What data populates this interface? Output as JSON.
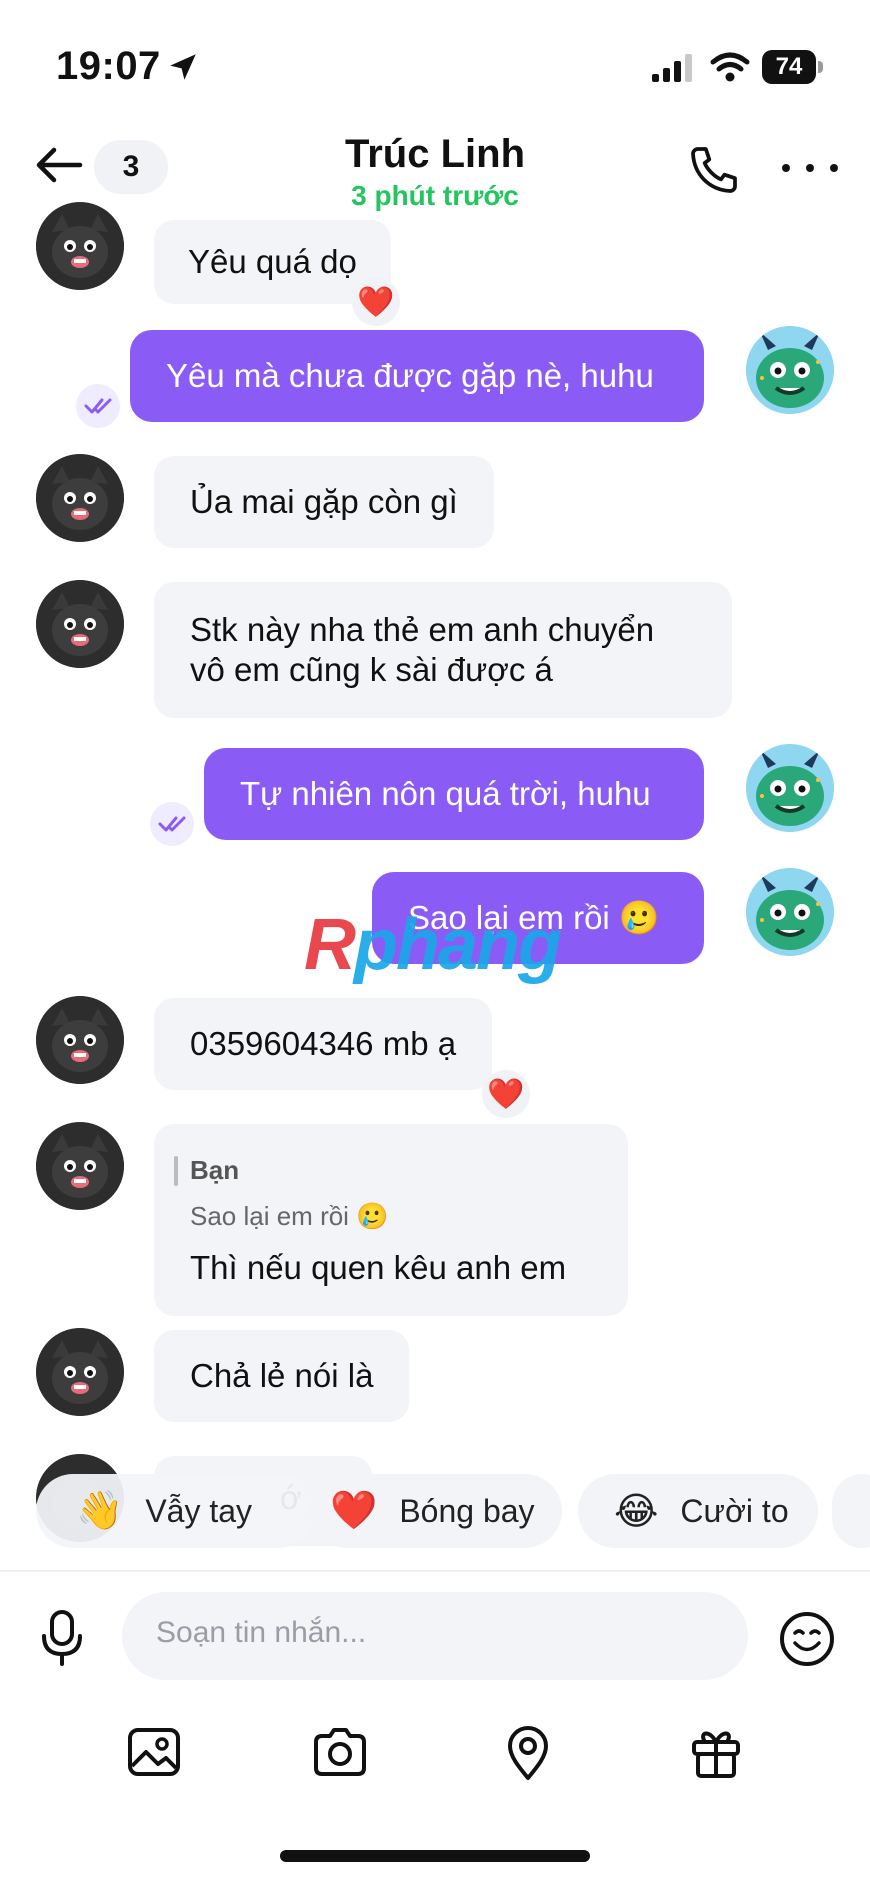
{
  "status_bar": {
    "time": "19:07",
    "battery": "74"
  },
  "header": {
    "back_count": "3",
    "title": "Trúc Linh",
    "subtitle": "3 phút trước"
  },
  "messages": [
    {
      "text": "Yêu quá dọ",
      "reaction": "❤️"
    },
    {
      "text": "Yêu mà chưa được gặp nè, huhu"
    },
    {
      "text": "Ủa mai gặp còn gì"
    },
    {
      "text_line1": "Stk này nha thẻ em anh chuyển",
      "text_line2": "vô em cũng k sài được á"
    },
    {
      "text": "Tự nhiên nôn quá trời, huhu"
    },
    {
      "text": "Sao lại em rồi 🥲"
    },
    {
      "text": "0359604346 mb ạ",
      "reaction": "❤️"
    },
    {
      "reply_name": "Bạn",
      "reply_text": "Sao lại em rồi 🥲",
      "text": "Thì nếu quen kêu anh em"
    },
    {
      "text": "Chả lẻ nói là"
    },
    {
      "text": "ớ"
    }
  ],
  "quick_reactions": [
    {
      "emoji": "👋",
      "label": "Vẫy tay"
    },
    {
      "emoji": "❤️",
      "label": "Bóng bay"
    },
    {
      "emoji": "😂",
      "label": "Cười to"
    }
  ],
  "composer": {
    "placeholder": "Soạn tin nhắn..."
  },
  "watermark": {
    "first": "R",
    "rest": "phang"
  },
  "colors": {
    "accent": "#8a5cf5",
    "online": "#22c55e"
  }
}
